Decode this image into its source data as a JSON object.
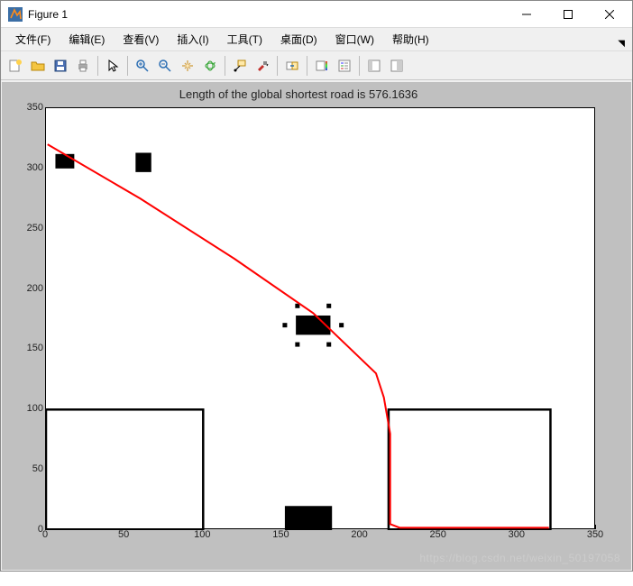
{
  "window": {
    "title": "Figure 1",
    "min_tooltip": "最小化",
    "max_tooltip": "最大化",
    "close_tooltip": "关闭"
  },
  "menubar": {
    "items": [
      "文件(F)",
      "编辑(E)",
      "查看(V)",
      "插入(I)",
      "工具(T)",
      "桌面(D)",
      "窗口(W)",
      "帮助(H)"
    ]
  },
  "toolbar": {
    "new": "新建",
    "open": "打开",
    "save": "保存",
    "print": "打印",
    "pointer": "编辑绘图",
    "zoom_in": "放大",
    "zoom_out": "缩小",
    "pan": "平移",
    "rotate": "旋转",
    "data_cursor": "数据游标",
    "brush": "刷选",
    "link": "链接绘图",
    "colorbar": "插入颜色栏",
    "legend": "插入图例",
    "hide_tools": "隐藏绘图工具",
    "dock": "停靠"
  },
  "chart_data": {
    "type": "line",
    "title": "Length of the global shortest road is 576.1636",
    "xlabel": "",
    "ylabel": "",
    "xlim": [
      0,
      350
    ],
    "ylim": [
      0,
      350
    ],
    "xticks": [
      0,
      50,
      100,
      150,
      200,
      250,
      300,
      350
    ],
    "yticks": [
      0,
      50,
      100,
      150,
      200,
      250,
      300,
      350
    ],
    "path": {
      "name": "shortest road",
      "color": "#ff0000",
      "points": [
        [
          1,
          320
        ],
        [
          60,
          275
        ],
        [
          120,
          225
        ],
        [
          170,
          180
        ],
        [
          210,
          130
        ],
        [
          215,
          110
        ],
        [
          219,
          80
        ],
        [
          219,
          40
        ],
        [
          219,
          5
        ],
        [
          225,
          2
        ],
        [
          260,
          2
        ],
        [
          300,
          2
        ],
        [
          320,
          2
        ]
      ]
    },
    "obstacles": [
      {
        "shape": "rect_outline",
        "x": 0,
        "y": 0,
        "w": 100,
        "h": 100
      },
      {
        "shape": "rect_outline",
        "x": 218,
        "y": 0,
        "w": 103,
        "h": 100
      },
      {
        "shape": "rect_fill",
        "x": 6,
        "y": 300,
        "w": 12,
        "h": 12
      },
      {
        "shape": "rect_fill",
        "x": 57,
        "y": 297,
        "w": 10,
        "h": 16
      },
      {
        "shape": "rect_fill",
        "x": 159,
        "y": 162,
        "w": 22,
        "h": 16
      },
      {
        "shape": "dot",
        "x": 160,
        "y": 186
      },
      {
        "shape": "dot",
        "x": 180,
        "y": 186
      },
      {
        "shape": "dot",
        "x": 152,
        "y": 170
      },
      {
        "shape": "dot",
        "x": 188,
        "y": 170
      },
      {
        "shape": "dot",
        "x": 160,
        "y": 154
      },
      {
        "shape": "dot",
        "x": 180,
        "y": 154
      },
      {
        "shape": "rect_fill",
        "x": 152,
        "y": 0,
        "w": 30,
        "h": 20
      }
    ]
  },
  "watermark": "https://blog.csdn.net/weixin_50197058"
}
